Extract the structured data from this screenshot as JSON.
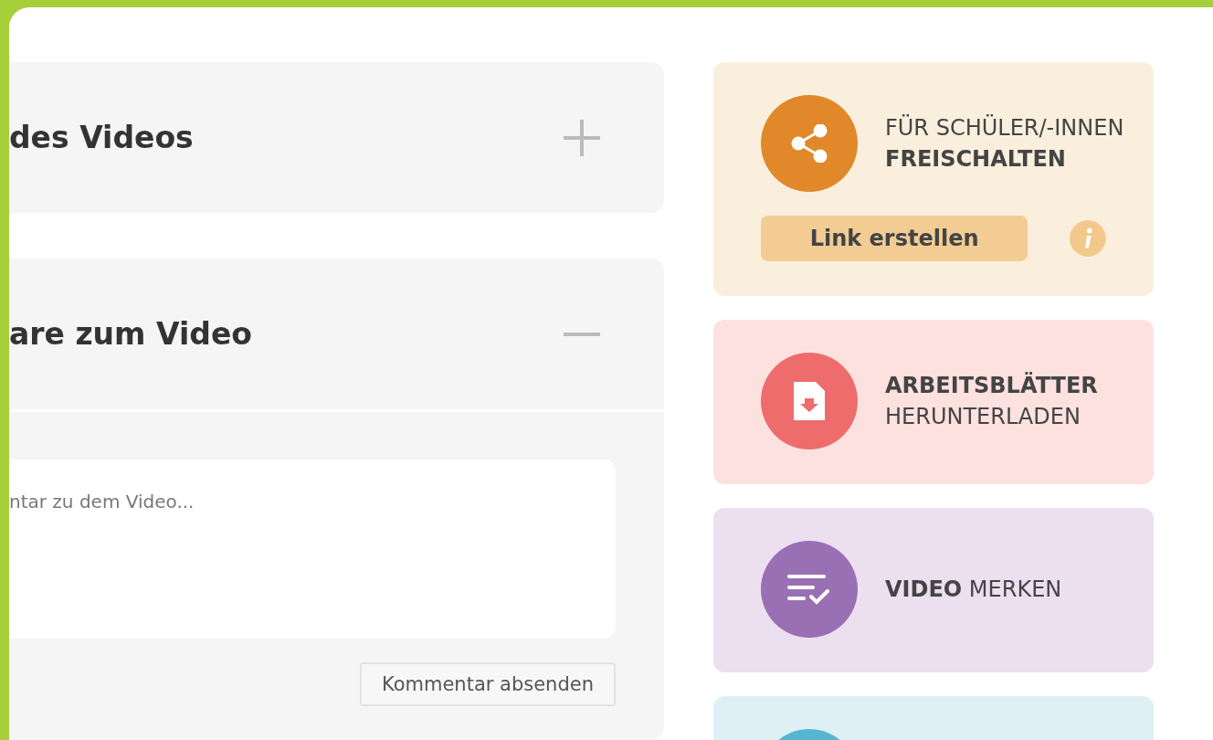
{
  "sections": [
    {
      "title": "des Videos",
      "expanded": false
    },
    {
      "title": "are zum Video",
      "expanded": true,
      "comment": {
        "placeholder": "ntar zu dem Video...",
        "button": "Kommentar absenden"
      }
    }
  ],
  "actions": [
    {
      "kind": "share",
      "color": "#e0882a",
      "lines": [
        {
          "text": "FÜR SCHÜLER/-INNEN",
          "bold": false
        },
        {
          "text": "FREISCHALTEN",
          "bold": true
        }
      ],
      "button": "Link erstellen"
    },
    {
      "kind": "download",
      "color": "#ee6c6c",
      "lines": [
        {
          "text": "ARBEITSBLÄTTER",
          "bold": true
        },
        {
          "text": "HERUNTERLADEN",
          "bold": false
        }
      ]
    },
    {
      "kind": "bookmark",
      "color": "#9a70b4",
      "lines": [
        {
          "text": "**VIDEO** MERKEN",
          "bold": false
        }
      ]
    },
    {
      "kind": "other",
      "color": "#56b6d2"
    }
  ]
}
